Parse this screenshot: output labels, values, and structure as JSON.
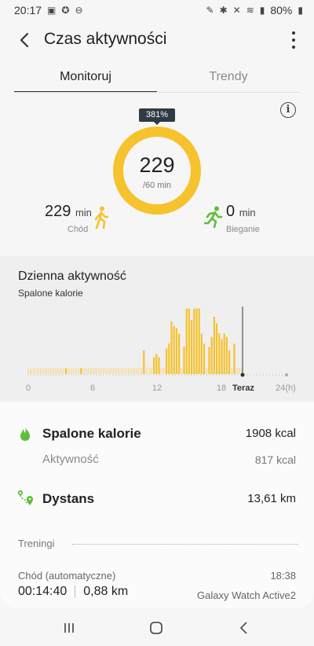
{
  "status_bar": {
    "time": "20:17",
    "battery": "80%"
  },
  "header": {
    "title": "Czas aktywności"
  },
  "tabs": [
    {
      "label": "Monitoruj",
      "active": true
    },
    {
      "label": "Trendy",
      "active": false
    }
  ],
  "summary": {
    "percent_badge": "381%",
    "value": "229",
    "goal": "/60 min",
    "walking": {
      "value": "229",
      "unit": "min",
      "label": "Chód"
    },
    "running": {
      "value": "0",
      "unit": "min",
      "label": "Bieganie"
    }
  },
  "daily": {
    "title": "Dzienna aktywność",
    "subtitle": "Spalone kalorie"
  },
  "chart_data": {
    "type": "bar",
    "x_ticks": [
      "0",
      "6",
      "12",
      "18",
      "Teraz",
      "24(h)"
    ],
    "bar_heights": [
      0.09,
      0.09,
      0.09,
      0.09,
      0.09,
      0.09,
      0.09,
      0.09,
      0.09,
      0.09,
      0.09,
      0.09,
      0.09,
      0.09,
      0.09,
      0.09,
      0.09,
      0.09,
      0.09,
      0.09,
      0.09,
      0.09,
      0.09,
      0.09,
      0.09,
      0.09,
      0.09,
      0.09,
      0.09,
      0.09,
      0.09,
      0.09,
      0.09,
      0.09,
      0.09,
      0.09,
      0.09,
      0.09,
      0.09,
      0.09,
      0.09,
      0.09,
      0.09,
      0.09,
      0.09,
      0.09,
      0.35,
      0.1,
      0.09,
      0.09,
      0.25,
      0.3,
      0.25,
      0.09,
      0.09,
      0.38,
      0.45,
      0.78,
      0.71,
      0.68,
      0.6,
      0.09,
      0.4,
      0.97,
      0.97,
      0.8,
      0.97,
      0.97,
      0.97,
      0.6,
      0.45,
      0.09,
      0.4,
      0.55,
      0.85,
      0.75,
      0.6,
      0.52,
      0.6,
      0.55,
      0.35,
      0.09,
      0.45,
      0.09,
      0.09,
      0.09
    ],
    "bar_states": [
      "faded",
      "faded",
      "faded",
      "faded",
      "faded",
      "faded",
      "faded",
      "faded",
      "faded",
      "faded",
      "faded",
      "faded",
      "faded",
      "faded",
      "faded",
      "faded",
      "faded",
      "faded",
      "faded",
      "faded",
      "faded",
      "faded",
      "faded",
      "faded",
      "faded",
      "faded",
      "faded",
      "faded",
      "faded",
      "faded",
      "faded",
      "faded",
      "faded",
      "faded",
      "faded",
      "faded",
      "faded",
      "faded",
      "faded",
      "faded",
      "faded",
      "faded",
      "faded",
      "faded",
      "faded",
      "faded",
      "bright",
      "faded",
      "faded",
      "faded",
      "bright",
      "bright",
      "bright",
      "faded",
      "faded",
      "bright",
      "bright",
      "bright",
      "bright",
      "bright",
      "bright",
      "faded",
      "bright",
      "bright",
      "bright",
      "bright",
      "bright",
      "bright",
      "bright",
      "bright",
      "bright",
      "faded",
      "bright",
      "bright",
      "bright",
      "bright",
      "bright",
      "bright",
      "bright",
      "bright",
      "bright",
      "faded",
      "bright",
      "faded",
      "faded",
      "faded"
    ],
    "extra_bright_indices": [
      15,
      21
    ],
    "ylim": [
      0,
      1
    ]
  },
  "stats": {
    "calories_label": "Spalone kalorie",
    "calories_value": "1908 kcal",
    "activity_label": "Aktywność",
    "activity_value": "817 kcal",
    "distance_label": "Dystans",
    "distance_value": "13,61 km"
  },
  "workouts": {
    "section_label": "Treningi",
    "name": "Chód (automatyczne)",
    "time": "18:38",
    "duration": "00:14:40",
    "distance": "0,88 km",
    "device": "Galaxy Watch Active2"
  },
  "colors": {
    "accent_yellow": "#f6c22d",
    "bar_faded": "#f5dfb4",
    "calories_green": "#5cbf3a",
    "distance_green": "#5cbf3a"
  },
  "icons": [
    "back-icon",
    "more-icon",
    "info-icon",
    "walking-icon",
    "running-icon",
    "flame-icon",
    "distance-icon",
    "recents-icon",
    "home-icon",
    "nav-back-icon"
  ]
}
